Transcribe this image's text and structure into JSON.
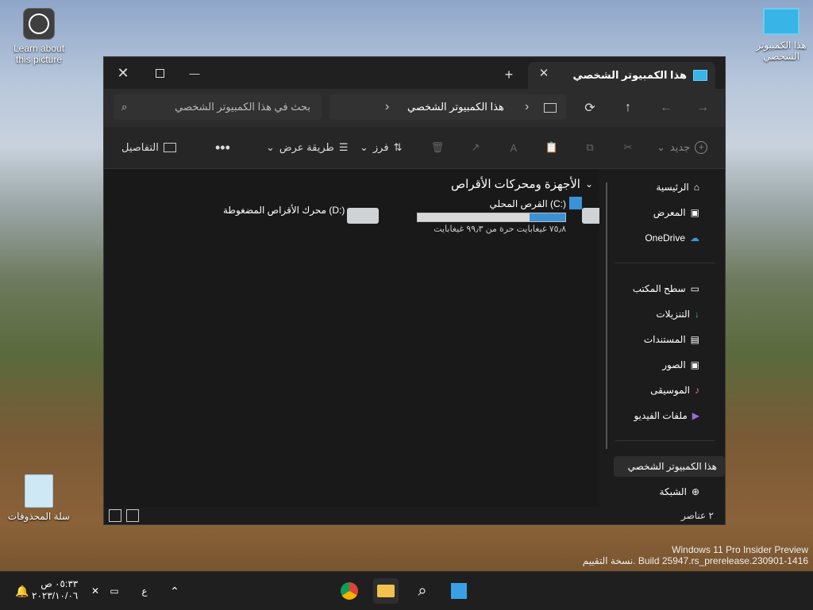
{
  "desktop": {
    "learn_label": "Learn about this picture",
    "pc_label": "هذا الكمبيوتر الشخصي",
    "recycle_label": "سلة المحذوفات"
  },
  "watermark": {
    "line1": "Windows 11 Pro Insider Preview",
    "line2": "نسخة التقييم. Build 25947.rs_prerelease.230901-1416"
  },
  "window": {
    "tab_title": "هذا الكمبيوتر الشخصي",
    "breadcrumb": "هذا الكمبيوتر الشخصي",
    "search_placeholder": "بحث في هذا الكمبيوتر الشخصي",
    "toolbar": {
      "new_label": "جديد",
      "sort_label": "فرز",
      "view_label": "طريقة عرض",
      "details_label": "التفاصيل"
    },
    "section_title": "الأجهزة ومحركات الأقراص",
    "drives": [
      {
        "name": "القرص المحلي (C:)",
        "free_text": "٧٥٫٨ غيغابايت حرة من ٩٩٫٣ غيغابايت",
        "used_fraction": 0.24
      },
      {
        "name": "محرك الأقراص المضغوطة (D:)"
      }
    ],
    "nav": {
      "home": "الرئيسية",
      "gallery": "المعرض",
      "onedrive": "OneDrive",
      "desktop": "سطح المكتب",
      "downloads": "التنزيلات",
      "documents": "المستندات",
      "pictures": "الصور",
      "music": "الموسيقى",
      "videos": "ملفات الفيديو",
      "this_pc": "هذا الكمبيوتر الشخصي",
      "network": "الشبكة"
    },
    "status_items": "٢ عناصر"
  },
  "taskbar": {
    "time": "٠٥:٣٣ ص",
    "date": "٢٠٢٣/١٠/٠٦",
    "lang": "ع"
  },
  "colors": {
    "accent": "#4aa3df",
    "drive_bar": "#3b93d6"
  }
}
